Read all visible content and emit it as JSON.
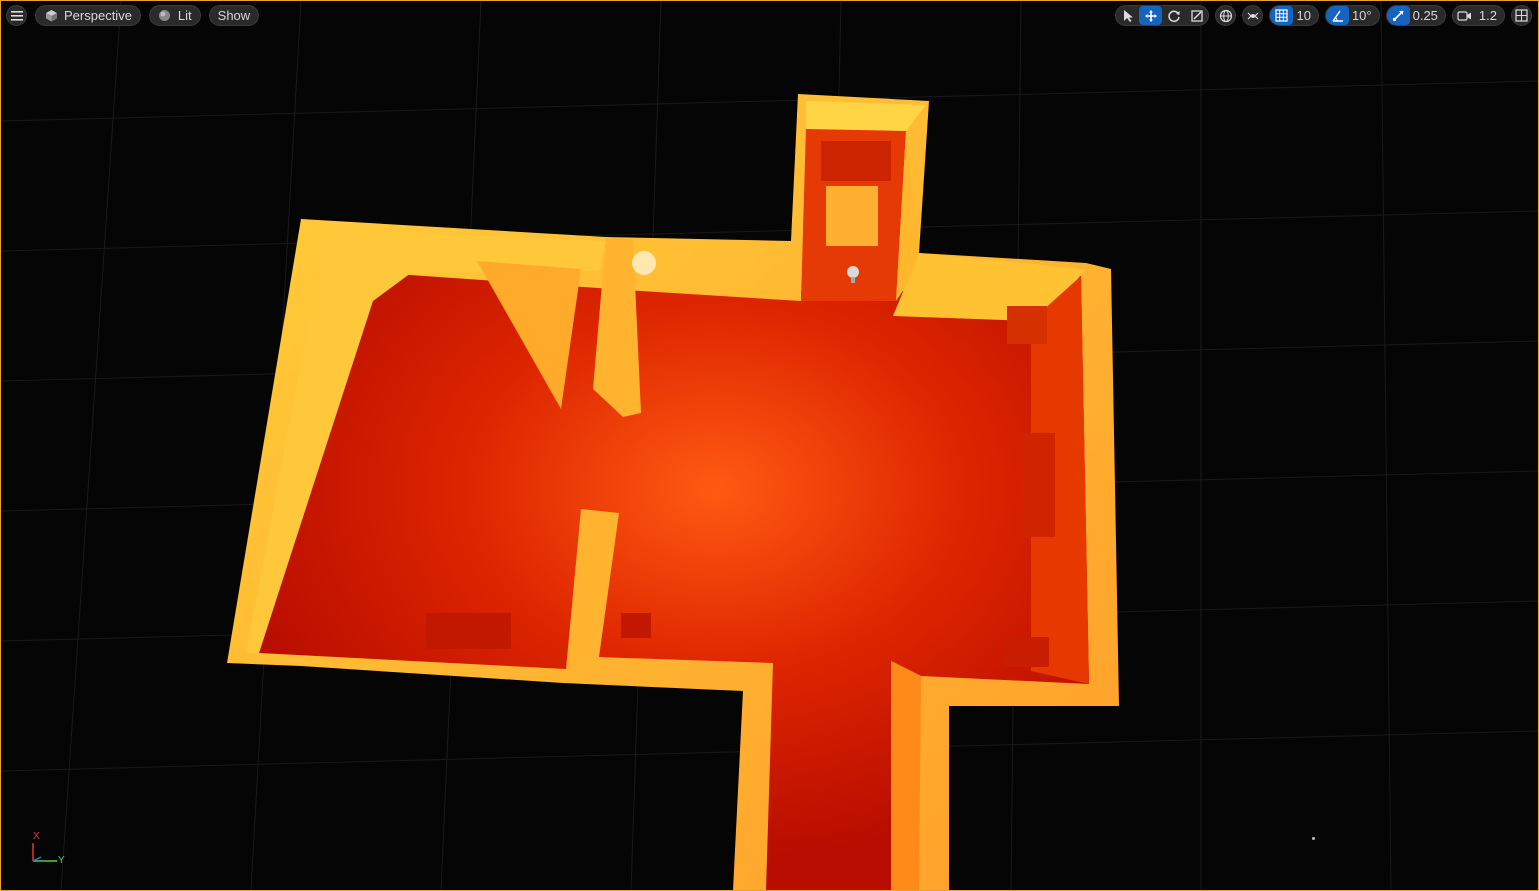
{
  "viewport": {
    "view_mode": "Perspective",
    "lit_mode": "Lit",
    "show_label": "Show"
  },
  "right_toolbar": {
    "grid_snap_value": "10",
    "rotation_snap_value": "10°",
    "scale_snap_value": "0.25",
    "camera_speed_value": "1.2"
  },
  "axis_gizmo": {
    "x_label": "X",
    "y_label": "Y"
  },
  "colors": {
    "border": "#e8a12a",
    "accent_blue": "#1565c0",
    "wall_top": "#ffb23a",
    "floor": "#cc1b00"
  }
}
